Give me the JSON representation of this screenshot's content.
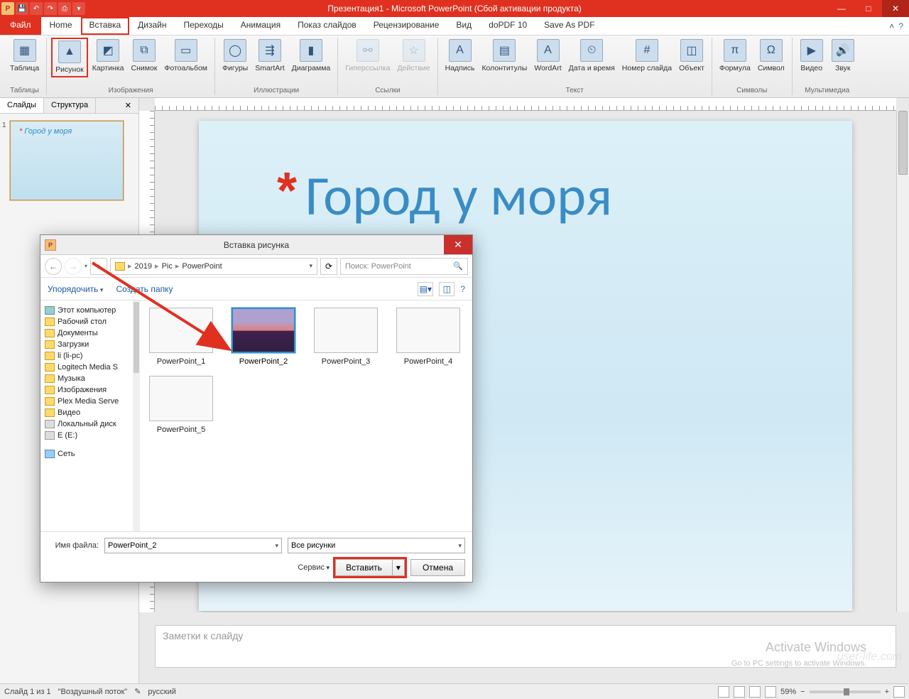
{
  "titlebar": {
    "title": "Презентация1 - Microsoft PowerPoint (Сбой активации продукта)"
  },
  "win": {
    "min": "—",
    "max": "□",
    "close": "✕"
  },
  "tabs": {
    "file": "Файл",
    "items": [
      "Home",
      "Вставка",
      "Дизайн",
      "Переходы",
      "Анимация",
      "Показ слайдов",
      "Рецензирование",
      "Вид",
      "doPDF 10",
      "Save As PDF"
    ],
    "highlighted_index": 1
  },
  "ribbon": {
    "groups": [
      {
        "label": "Таблицы",
        "items": [
          {
            "name": "Таблица",
            "icon": "▦"
          }
        ]
      },
      {
        "label": "Изображения",
        "items": [
          {
            "name": "Рисунок",
            "icon": "▲",
            "hl": true
          },
          {
            "name": "Картинка",
            "icon": "◩"
          },
          {
            "name": "Снимок",
            "icon": "⧉"
          },
          {
            "name": "Фотоальбом",
            "icon": "▭"
          }
        ]
      },
      {
        "label": "Иллюстрации",
        "items": [
          {
            "name": "Фигуры",
            "icon": "◯"
          },
          {
            "name": "SmartArt",
            "icon": "⇶"
          },
          {
            "name": "Диаграмма",
            "icon": "▮"
          }
        ]
      },
      {
        "label": "Ссылки",
        "items": [
          {
            "name": "Гиперссылка",
            "icon": "⚯",
            "disabled": true
          },
          {
            "name": "Действие",
            "icon": "☆",
            "disabled": true
          }
        ]
      },
      {
        "label": "Текст",
        "items": [
          {
            "name": "Надпись",
            "icon": "A"
          },
          {
            "name": "Колонтитулы",
            "icon": "▤"
          },
          {
            "name": "WordArt",
            "icon": "A"
          },
          {
            "name": "Дата и время",
            "icon": "⏲"
          },
          {
            "name": "Номер слайда",
            "icon": "#"
          },
          {
            "name": "Объект",
            "icon": "◫"
          }
        ]
      },
      {
        "label": "Символы",
        "items": [
          {
            "name": "Формула",
            "icon": "π"
          },
          {
            "name": "Символ",
            "icon": "Ω"
          }
        ]
      },
      {
        "label": "Мультимедиа",
        "items": [
          {
            "name": "Видео",
            "icon": "▶"
          },
          {
            "name": "Звук",
            "icon": "🔊"
          }
        ]
      }
    ]
  },
  "leftpanel": {
    "tab_slides": "Слайды",
    "tab_outline": "Структура",
    "slide_num": "1",
    "slide_title": "Город у моря"
  },
  "slide": {
    "title": "Город у моря"
  },
  "notes": {
    "placeholder": "Заметки к слайду"
  },
  "status": {
    "slide": "Слайд 1 из 1",
    "theme": "\"Воздушный поток\"",
    "lang": "русский",
    "zoom": "59%"
  },
  "watermark": {
    "l1": "Activate Windows",
    "l2": "Go to PC settings to activate Windows.",
    "url": "user-life.com"
  },
  "dialog": {
    "title": "Вставка рисунка",
    "breadcrumb": [
      "2019",
      "Pic",
      "PowerPoint"
    ],
    "search_placeholder": "Поиск: PowerPoint",
    "organize": "Упорядочить",
    "newfolder": "Создать папку",
    "tree": [
      {
        "t": "comp",
        "n": "Этот компьютер"
      },
      {
        "t": "f",
        "n": "Рабочий стол"
      },
      {
        "t": "f",
        "n": "Документы"
      },
      {
        "t": "f",
        "n": "Загрузки"
      },
      {
        "t": "f",
        "n": "li (li-pc)"
      },
      {
        "t": "f",
        "n": "Logitech Media S"
      },
      {
        "t": "f",
        "n": "Музыка"
      },
      {
        "t": "f",
        "n": "Изображения"
      },
      {
        "t": "f",
        "n": "Plex Media Serve"
      },
      {
        "t": "f",
        "n": "Видео"
      },
      {
        "t": "drv",
        "n": "Локальный диск"
      },
      {
        "t": "drv",
        "n": "E (E:)"
      },
      {
        "t": "sep",
        "n": ""
      },
      {
        "t": "net",
        "n": "Сеть"
      }
    ],
    "files": [
      {
        "n": "PowerPoint_1"
      },
      {
        "n": "PowerPoint_2",
        "sel": true,
        "sunset": true
      },
      {
        "n": "PowerPoint_3"
      },
      {
        "n": "PowerPoint_4"
      },
      {
        "n": "PowerPoint_5"
      }
    ],
    "filename_label": "Имя файла:",
    "filename_value": "PowerPoint_2",
    "filter": "Все рисунки",
    "tools": "Сервис",
    "insert": "Вставить",
    "cancel": "Отмена"
  }
}
